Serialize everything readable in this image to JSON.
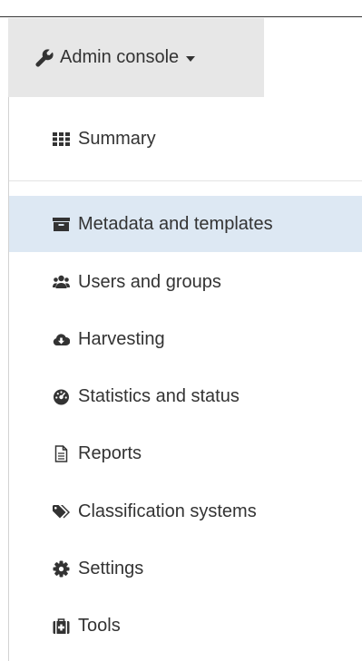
{
  "console": {
    "label": "Admin console",
    "icon": "wrench-icon"
  },
  "menu": {
    "items": [
      {
        "label": "Summary",
        "icon": "th-grid-icon"
      },
      {
        "label": "Metadata and templates",
        "icon": "archive-icon",
        "active": true
      },
      {
        "label": "Users and groups",
        "icon": "users-icon"
      },
      {
        "label": "Harvesting",
        "icon": "cloud-download-icon"
      },
      {
        "label": "Statistics and status",
        "icon": "dashboard-icon"
      },
      {
        "label": "Reports",
        "icon": "file-text-icon"
      },
      {
        "label": "Classification systems",
        "icon": "tags-icon"
      },
      {
        "label": "Settings",
        "icon": "cog-icon"
      },
      {
        "label": "Tools",
        "icon": "medkit-icon"
      }
    ]
  },
  "colors": {
    "active_bg": "#dde8f3",
    "button_bg": "#e7e7e7",
    "text": "#333333"
  }
}
